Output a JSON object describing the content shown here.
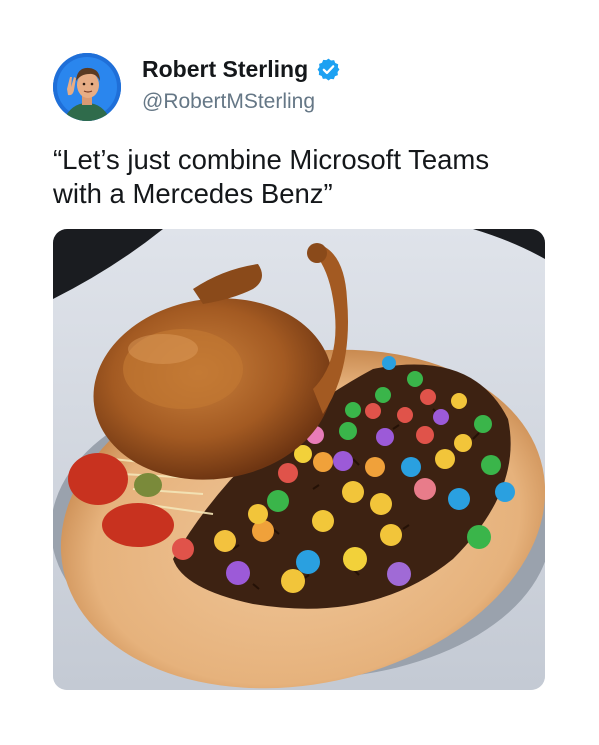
{
  "tweet": {
    "author": {
      "display_name": "Robert Sterling",
      "handle": "@RobertMSterling",
      "verified": true
    },
    "text_lines": [
      "“Let’s just combine Microsoft Teams",
      "with a Mercedes Benz”"
    ],
    "media": {
      "icon": "photo-icon"
    }
  },
  "colors": {
    "verified_badge": "#1da1f2",
    "handle": "#657786",
    "text": "#14171a",
    "avatar_bg": "#1f6fd8"
  }
}
